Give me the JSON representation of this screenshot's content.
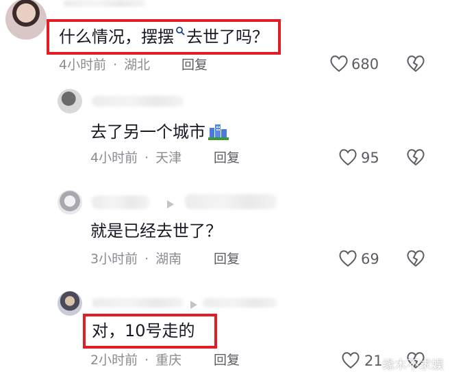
{
  "comments": [
    {
      "text": "什么情况，摆摆",
      "text_suffix": "去世了吗？",
      "time": "4小时前",
      "location": "湖北",
      "reply_label": "回复",
      "likes": "680"
    },
    {
      "text": "去了另一个城市",
      "time": "4小时前",
      "location": "天津",
      "reply_label": "回复",
      "likes": "95"
    },
    {
      "text": "就是已经去世了？",
      "time": "3小时前",
      "location": "湖南",
      "reply_label": "回复",
      "likes": "69"
    },
    {
      "text": "对，10号走的",
      "time": "2小时前",
      "location": "重庆",
      "reply_label": "回复",
      "likes": "21"
    }
  ],
  "watermark": "缘木不求娱",
  "colors": {
    "highlight": "#e31b23",
    "link": "#1a3a8a",
    "meta": "#8a8b91"
  },
  "icons": [
    "search-icon",
    "heart-icon",
    "dislike-heart-icon",
    "city-emoji-icon",
    "play-arrow-icon"
  ]
}
